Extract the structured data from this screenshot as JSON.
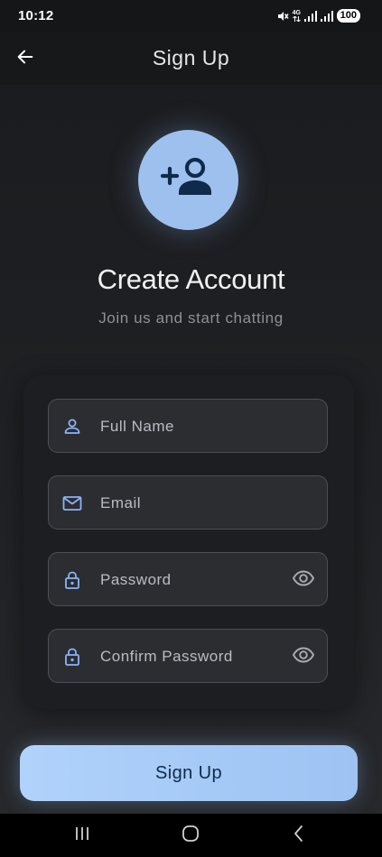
{
  "status_bar": {
    "time": "10:12",
    "network": "4G",
    "battery": "100",
    "icons": [
      "mute-icon",
      "network-4g-icon",
      "signal-icon",
      "signal-icon",
      "battery-icon"
    ]
  },
  "app_bar": {
    "title": "Sign Up",
    "back_icon": "arrow-back-icon"
  },
  "hero": {
    "icon": "person-add-icon",
    "title": "Create Account",
    "subtitle": "Join us and start chatting"
  },
  "form": {
    "fields": [
      {
        "label": "Full Name",
        "icon": "person-icon",
        "value": ""
      },
      {
        "label": "Email",
        "icon": "mail-icon",
        "value": ""
      },
      {
        "label": "Password",
        "icon": "lock-icon",
        "value": "",
        "toggle_icon": "eye-icon"
      },
      {
        "label": "Confirm Password",
        "icon": "lock-icon",
        "value": "",
        "toggle_icon": "eye-icon"
      }
    ]
  },
  "submit": {
    "label": "Sign Up"
  },
  "nav_bar": {
    "items": [
      "recents-icon",
      "home-icon",
      "back-icon"
    ]
  },
  "colors": {
    "accent": "#9ec3f3",
    "icon_blue": "#8ab4f8",
    "dark_icon": "#0f2a4a",
    "background": "#1f2124",
    "field_border": "#4c4f55"
  }
}
